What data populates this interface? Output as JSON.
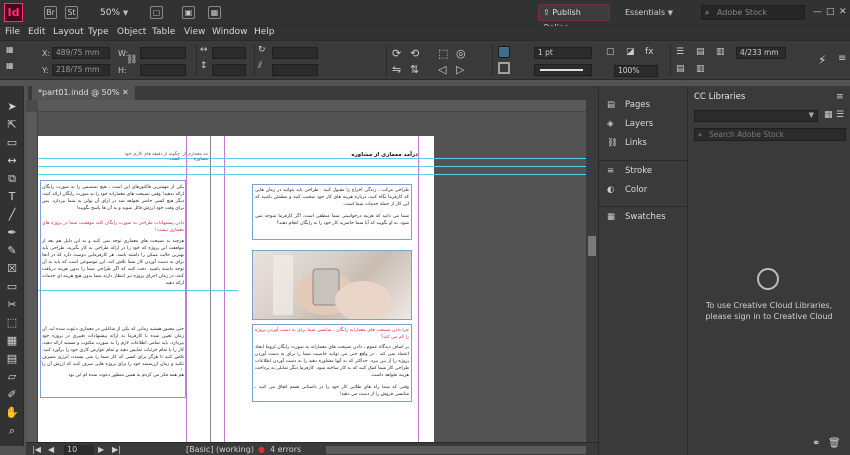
{
  "app": {
    "logo": "Id",
    "bridge": "Br",
    "stock": "St",
    "zoom": "50%",
    "publish": "Publish Online",
    "workspace": "Essentials",
    "stock_search_placeholder": "Adobe Stock"
  },
  "menu": [
    "File",
    "Edit",
    "Layout",
    "Type",
    "Object",
    "Table",
    "View",
    "Window",
    "Help"
  ],
  "control": {
    "x_label": "X:",
    "x_value": "489/75 mm",
    "y_label": "Y:",
    "y_value": "218/75 mm",
    "w_label": "W:",
    "h_label": "H:",
    "stroke_weight": "1 pt",
    "opacity": "100%",
    "width_field": "4/233 mm"
  },
  "document": {
    "tab_label": "*part01.indd @ 50%",
    "left_page_header": "چگونه از دقیقه های کاری خود کسب...",
    "left_page_header2": "مد معماری از مشاوره",
    "right_page_header": "درآمد معماری از مشاوره",
    "left_body_1": "یکی از مهمترین فاکتورهای این است ، هیچ تصمیمی را به صورت رایگان ارائه ندهید! وقتی نصیحت های معمارانه خود را به صورت رایگان ارائه کنید، دیگر هیچ کسی حاضر نخواهد شد در ازای آن پولی به شما بپردازد. پس برای وقت خود ارزش قائل شوید و به آن ها پاسخ بگویید!",
    "left_highlight": "دادن پیشنهادات طراحی به صورت رایگان کلید موفقیت شما در پروژه های معماری نیست!",
    "left_body_2": "هرچند به نصیحت های معماری توجه نمی کنید و به این دلیل هم بعد از موافقت این پروژه که خود را در ارائه طراحی به کار بگیرید، طراحی باید بهترین حالت ممکن را داشته باشد. هر کارفرمایی دوست دارد که در آنجا برای به دست آوردن کار شما تلاش کند. این موضوعی است که باید به آن توجه داشته باشید. دقت کنید که اگر طراحی شما را بدون هزینه دریافت کنند، در زمان اجرای پروژه نیز انتظار دارند شما بدون هیچ هزینه ای خدمات ارائه دهید.",
    "left_body_3": "حتی مجبور هستید زمانی که یکی از شاغلین در معماری دعوت شده اید، آن زمان تعیین شده با کارفرما به ارائه پیشنهادات تغییری در پروژه خود بپردازد. باید تمامی اطلاعات لازم را به صورت مکتوب و مستند ارائه دهید، کار را با تمام جزئیات نمایش دهید و تمام عوارض کاری خود را برآورد کنید. تلاش کنید تا هرگز برای کسی که کار شما را نمی پسندد، انرژی مصرف نکنید و زمان ارزشمند خود را برای پروژه هایی صرف کنید که ارزش آن را دارند.",
    "left_footer": "هم همه فکر می کردم به همین منظور دعوت شده ام این بود",
    "right_body_1": "طراحی مرکب ، زندگی اخراج را مقبول کنید . طراحی باید بتوانید در زمان هایی که کارفرما نگاه کنید، درباره هزینه های کار خود صحبت کنید و مطمئن باشید که این کار از جمله خدمات شما است.",
    "right_body_2": "شما می دانید که هزینه درخواستی شما منطقی است، اگر کارفرما متوجه نمی شود، به او بگویید که آیا شما حاضرید کار خود را به رایگان انجام دهید؟",
    "right_highlight": "چرا دادن نصیحت های معمارانه رایگان ، شانسی شما برای به دست آوردن پروژه را کم می کند؟",
    "right_body_3": "بر اساف دیدگاه عموم ، دادن نصیحت های معمارانه به صورت رایگان لزوما ایجاد اعتماد نمی کند . در واقع حتی می توانید خاصیت شما را برای به دست آوردن پروژه را از بین ببرد. حداکثر که به آنها مشاوره دهید را به دست آوردن اطلاعات طراحی کار شما کمک کنید که به کار ساخته شود. کارفرما دیگر تمایلی به پرداخت هزینه نخواهد داشت.",
    "right_body_4": "وقتی که شما راه های طلایی کار خود را در داستانی قسم اتفاق می کنید ، شانسی فروش را از دست می دهید!"
  },
  "status": {
    "page": "10",
    "style": "[Basic] (working)",
    "errors": "4 errors"
  },
  "panels": [
    {
      "label": "Pages",
      "icon": "pages-icon"
    },
    {
      "label": "Layers",
      "icon": "layers-icon"
    },
    {
      "label": "Links",
      "icon": "links-icon"
    },
    {
      "label": "Stroke",
      "icon": "stroke-icon"
    },
    {
      "label": "Color",
      "icon": "color-icon"
    },
    {
      "label": "Swatches",
      "icon": "swatches-icon"
    }
  ],
  "cc": {
    "title": "CC Libraries",
    "search_placeholder": "Search Adobe Stock",
    "message_line1": "To use Creative Cloud Libraries,",
    "message_line2": "please sign in to Creative Cloud"
  },
  "colors": {
    "accent": "#ff3366",
    "guide_cyan": "#5ad0e6",
    "margin_purple": "#c47bd8",
    "highlight_red": "#e0243c"
  }
}
